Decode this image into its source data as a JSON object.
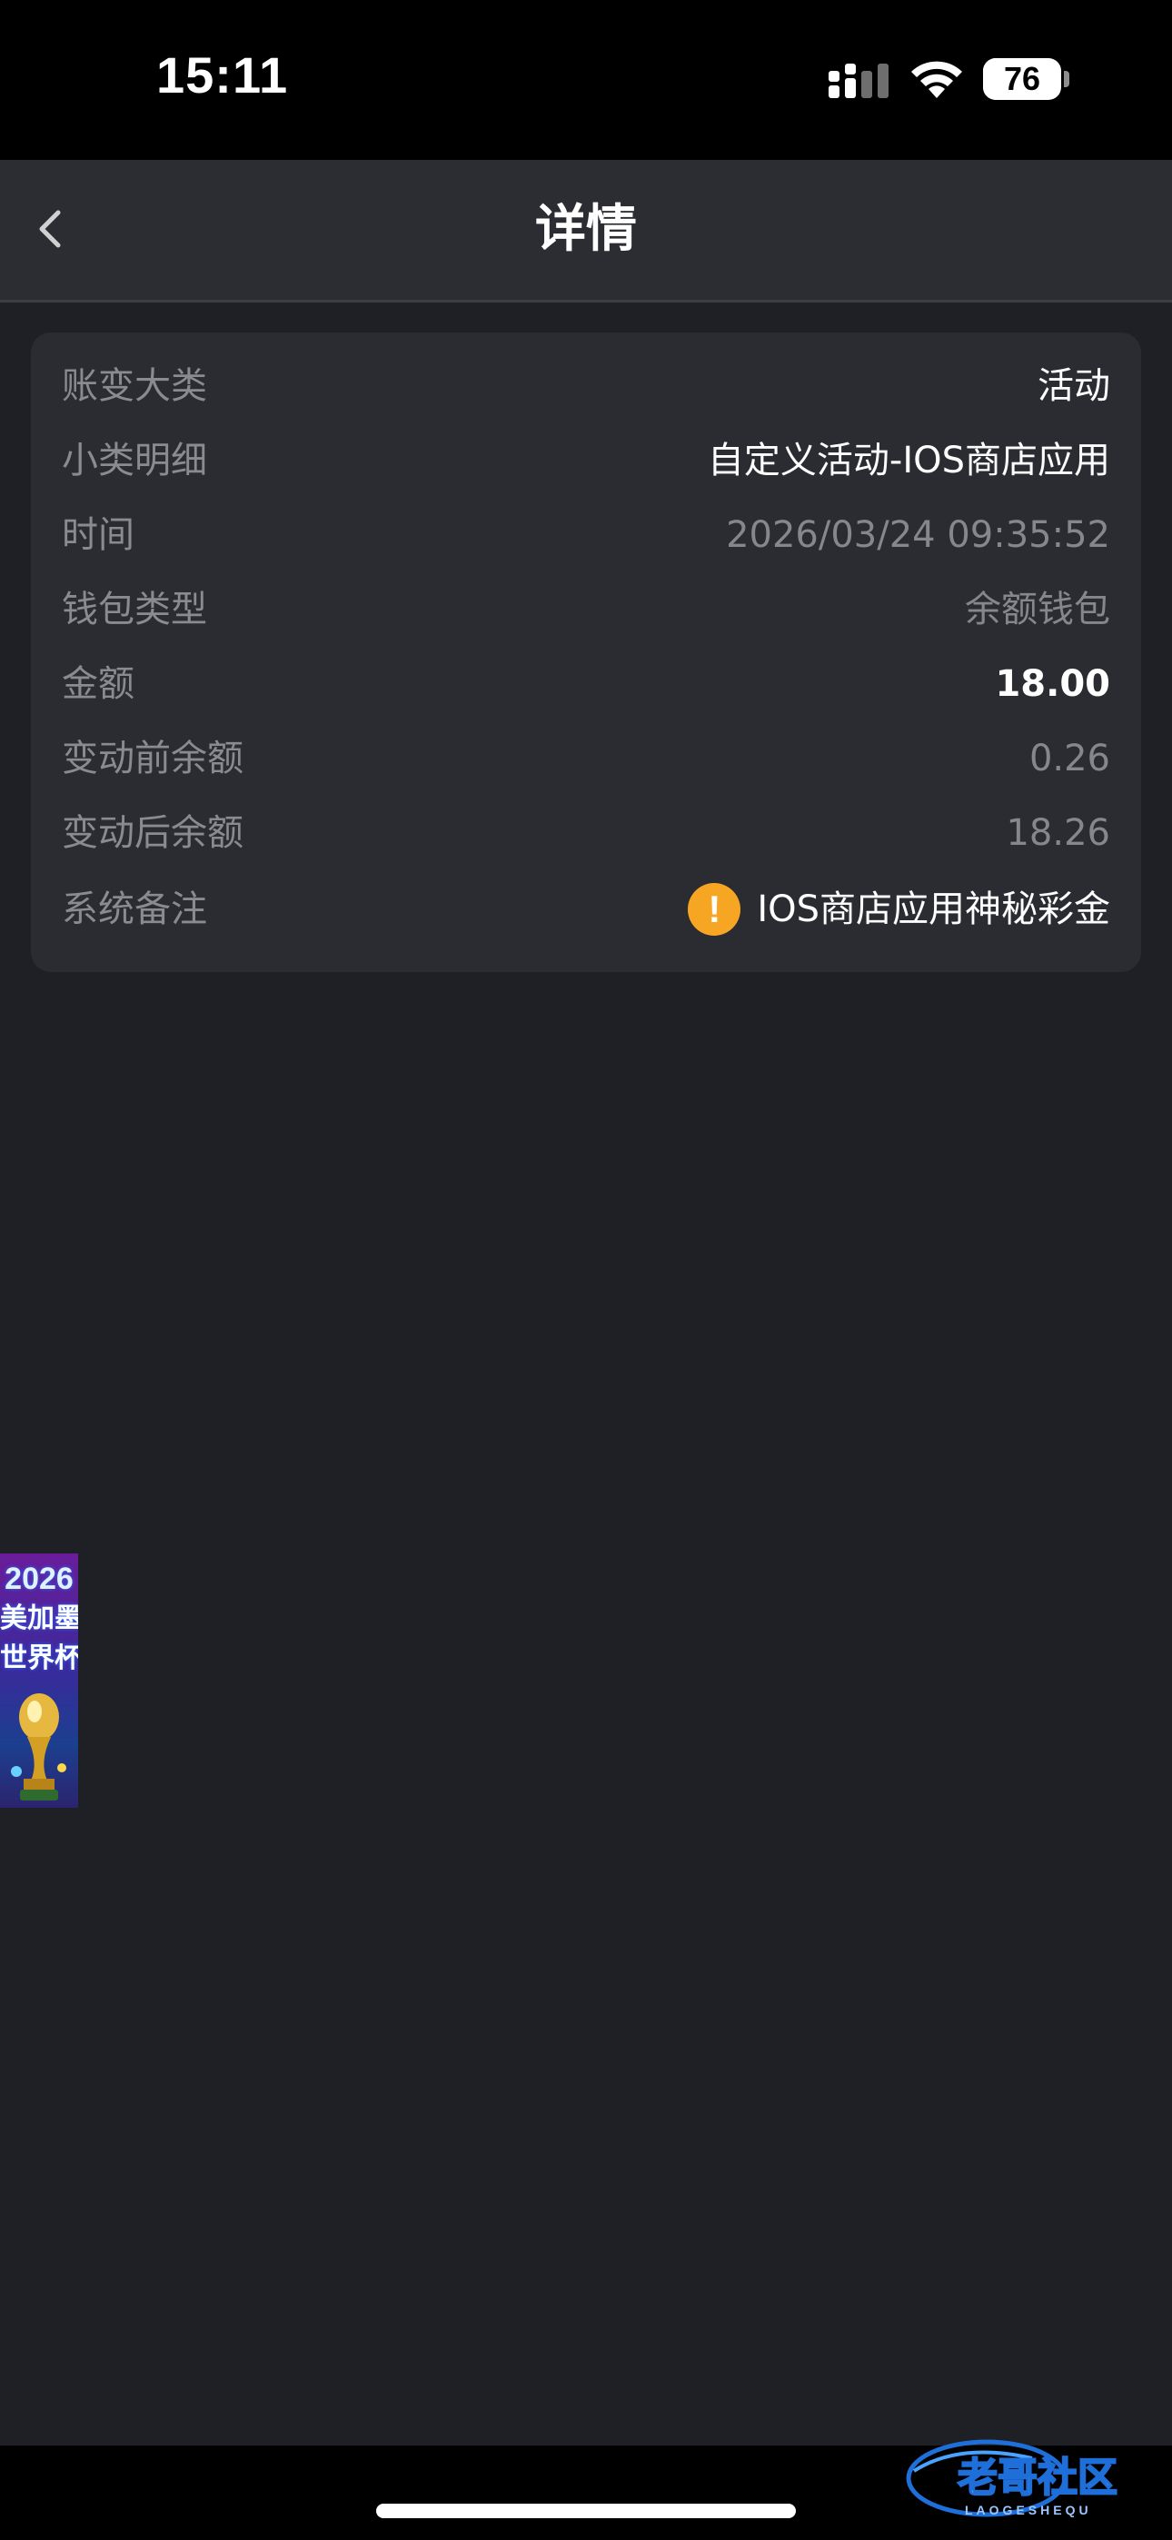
{
  "status_bar": {
    "time": "15:11",
    "battery": "76",
    "battery_fraction": 0.76,
    "signal_icon": "cellular-signal-icon",
    "wifi_icon": "wifi-icon"
  },
  "nav": {
    "title": "详情",
    "back_icon": "chevron-left-icon"
  },
  "details": {
    "rows": [
      {
        "label": "账变大类",
        "value": "活动"
      },
      {
        "label": "小类明细",
        "value": "自定义活动-IOS商店应用"
      },
      {
        "label": "时间",
        "value": "2026/03/24 09:35:52"
      },
      {
        "label": "钱包类型",
        "value": "余额钱包"
      },
      {
        "label": "金额",
        "value": "18.00"
      },
      {
        "label": "变动前余额",
        "value": "0.26"
      },
      {
        "label": "变动后余额",
        "value": "18.26"
      },
      {
        "label": "系统备注",
        "value": "IOS商店应用神秘彩金",
        "icon": "warning-icon"
      }
    ]
  },
  "float_banner": {
    "year": "2026",
    "line2": "美加墨",
    "line3": "世界杯"
  },
  "watermark": {
    "text": "老哥社区",
    "subtext": "LAOGESHEQU"
  },
  "colors": {
    "background": "#1f2025",
    "card": "#2b2c31",
    "label": "#8a8b90",
    "warning": "#f6a623"
  }
}
